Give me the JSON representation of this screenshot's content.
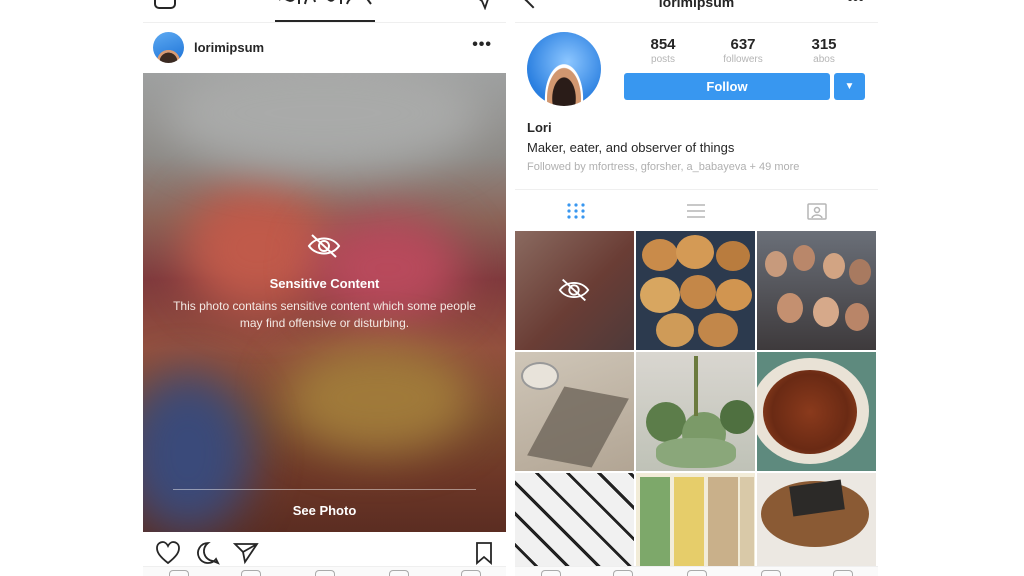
{
  "feed": {
    "username": "lorimipsum",
    "more_label": "•••",
    "sensitive_title": "Sensitive Content",
    "sensitive_body": "This photo contains sensitive content which some people may find offensive or disturbing.",
    "see_photo_label": "See Photo"
  },
  "profile": {
    "username": "lorimipsum",
    "more_label": "•••",
    "stats": [
      {
        "value": "854",
        "label": "posts"
      },
      {
        "value": "637",
        "label": "followers"
      },
      {
        "value": "315",
        "label": "abos"
      }
    ],
    "follow_label": "Follow",
    "dropdown_label": "▼",
    "name": "Lori",
    "bio": "Maker, eater, and observer of things",
    "followed_by": "Followed by mfortress, gforsher, a_babayeva + 49 more"
  },
  "colors": {
    "accent": "#3897f0",
    "muted_text": "#b0b0b0"
  }
}
